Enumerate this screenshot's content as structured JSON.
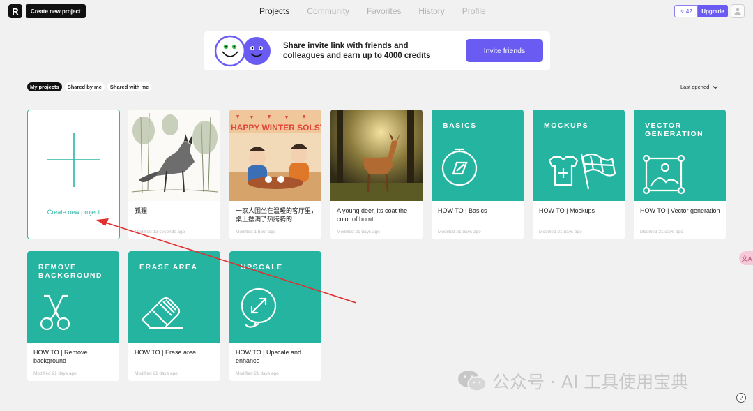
{
  "topbar": {
    "logo_letter": "R",
    "create_label": "Create new project",
    "nav": [
      "Projects",
      "Community",
      "Favorites",
      "History",
      "Profile"
    ],
    "active_nav": "Projects",
    "credits": "42",
    "upgrade_label": "Upgrade"
  },
  "banner": {
    "text": "Share invite link with friends and colleagues and earn up to 4000 credits",
    "button_label": "Invite friends"
  },
  "filters": {
    "tabs": [
      "My projects",
      "Shared by me",
      "Shared with me"
    ],
    "active_tab": "My projects",
    "sort_label": "Last opened"
  },
  "new_project": {
    "label": "Create new project"
  },
  "projects": [
    {
      "title": "狐狸",
      "meta": "Modified 13 seconds ago",
      "thumb": "fox-sketch"
    },
    {
      "title": "一家人围坐在温暖的客厅里，桌上摆满了热腾腾的...",
      "meta": "Modified 1 hour ago",
      "thumb": "winter-solstice",
      "thumb_text": "HAPPY WINTER SOLSTIC"
    },
    {
      "title": "A young deer, its coat the color of burnt ...",
      "meta": "Modified 21 days ago",
      "thumb": "deer-forest"
    },
    {
      "title": "HOW TO | Basics",
      "meta": "Modified 21 days ago",
      "thumb": "teal",
      "teal_title": "BASICS",
      "icon": "basics-icon"
    },
    {
      "title": "HOW TO | Mockups",
      "meta": "Modified 21 days ago",
      "thumb": "teal",
      "teal_title": "MOCKUPS",
      "icon": "mockups-icon"
    },
    {
      "title": "HOW TO | Vector generation",
      "meta": "Modified 21 days ago",
      "thumb": "teal",
      "teal_title": "VECTOR GENERATION",
      "icon": "vector-icon"
    },
    {
      "title": "HOW TO | Remove background",
      "meta": "Modified 21 days ago",
      "thumb": "teal",
      "teal_title": "REMOVE BACKGROUND",
      "icon": "scissors-icon"
    },
    {
      "title": "HOW TO | Erase area",
      "meta": "Modified 21 days ago",
      "thumb": "teal",
      "teal_title": "ERASE AREA",
      "icon": "eraser-icon"
    },
    {
      "title": "HOW TO | Upscale and enhance",
      "meta": "Modified 21 days ago",
      "thumb": "teal",
      "teal_title": "UPSCALE",
      "icon": "upscale-icon"
    }
  ],
  "translate_label": "文A",
  "watermark": "公众号 · AI 工具使用宝典",
  "help_label": "?",
  "colors": {
    "teal": "#24b4a0",
    "accent": "#6a5cf2",
    "annotation_arrow": "#e03030"
  }
}
